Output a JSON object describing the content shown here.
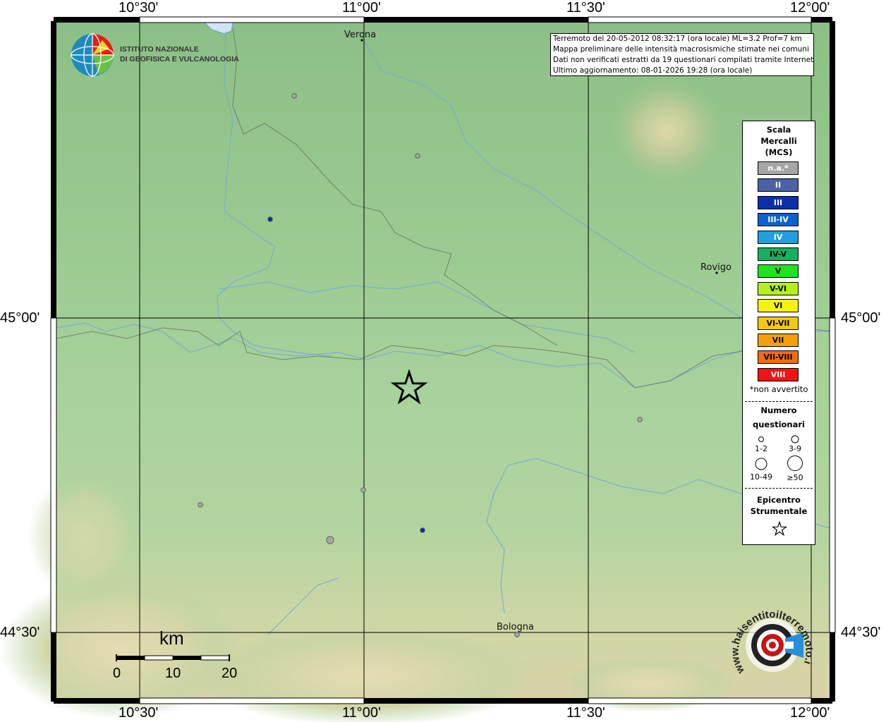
{
  "grid": {
    "lon_labels": [
      "10°30'",
      "11°00'",
      "11°30'",
      "12°00'"
    ],
    "lat_labels": [
      "45°00'",
      "44°30'"
    ]
  },
  "cities": {
    "verona": "Verona",
    "rovigo": "Rovigo",
    "bologna": "Bologna"
  },
  "info_box": {
    "line1": "Terremoto del 20-05-2012 08:32:17 (ora locale) ML=3.2 Prof=7 km",
    "line2": "Mappa preliminare delle intensità macrosismiche stimate nei comuni",
    "line3": "Dati non verificati estratti da 19 questionari compilati tramite Internet.",
    "line4": "Ultimo aggiornamento: 08-01-2026 19:28 (ora locale)"
  },
  "ingv": {
    "line1": "ISTITUTO NAZIONALE",
    "line2": "DI GEOFISICA E VULCANOLOGIA"
  },
  "legend": {
    "title_line1": "Scala",
    "title_line2": "Mercalli",
    "title_line3": "(MCS)",
    "classes": [
      {
        "label": "n.a.*",
        "color": "#a6a6a6",
        "text_color": "#ffffff"
      },
      {
        "label": "II",
        "color": "#4a63a8",
        "text_color": "#ffffff"
      },
      {
        "label": "III",
        "color": "#0a2fa8",
        "text_color": "#ffffff"
      },
      {
        "label": "III-IV",
        "color": "#0a63cc",
        "text_color": "#ffffff"
      },
      {
        "label": "IV",
        "color": "#1fa0e0",
        "text_color": "#ffffff"
      },
      {
        "label": "IV-V",
        "color": "#16b060",
        "text_color": "#000000"
      },
      {
        "label": "V",
        "color": "#22e022",
        "text_color": "#000000"
      },
      {
        "label": "V-VI",
        "color": "#b4f01e",
        "text_color": "#000000"
      },
      {
        "label": "VI",
        "color": "#f5f50a",
        "text_color": "#000000"
      },
      {
        "label": "VI-VII",
        "color": "#f5c80a",
        "text_color": "#000000"
      },
      {
        "label": "VII",
        "color": "#f5a00a",
        "text_color": "#000000"
      },
      {
        "label": "VII-VIII",
        "color": "#f06e0a",
        "text_color": "#000000"
      },
      {
        "label": "VIII",
        "color": "#f01414",
        "text_color": "#ffffff"
      }
    ],
    "na_note": "*non avvertito",
    "count_title_line1": "Numero",
    "count_title_line2": "questionari",
    "count_classes": [
      "1-2",
      "3-9",
      "10-49",
      "≥50"
    ],
    "epicenter_line1": "Epicentro",
    "epicenter_line2": "Strumentale"
  },
  "scale_bar": {
    "unit": "km",
    "ticks": [
      "0",
      "10",
      "20"
    ]
  },
  "observations": [
    {
      "intensity": "n.a.*",
      "count_class": "1-2"
    },
    {
      "intensity": "n.a.*",
      "count_class": "1-2"
    },
    {
      "intensity": "III",
      "count_class": "1-2"
    },
    {
      "intensity": "n.a.*",
      "count_class": "1-2"
    },
    {
      "intensity": "n.a.*",
      "count_class": "1-2"
    },
    {
      "intensity": "n.a.*",
      "count_class": "1-2"
    },
    {
      "intensity": "n.a.*",
      "count_class": "3-9"
    },
    {
      "intensity": "III",
      "count_class": "1-2"
    },
    {
      "intensity": "n.a.*",
      "count_class": "1-2"
    }
  ],
  "haisentito": {
    "text": "haisentitoilterremoto.it",
    "prefix": "www."
  }
}
